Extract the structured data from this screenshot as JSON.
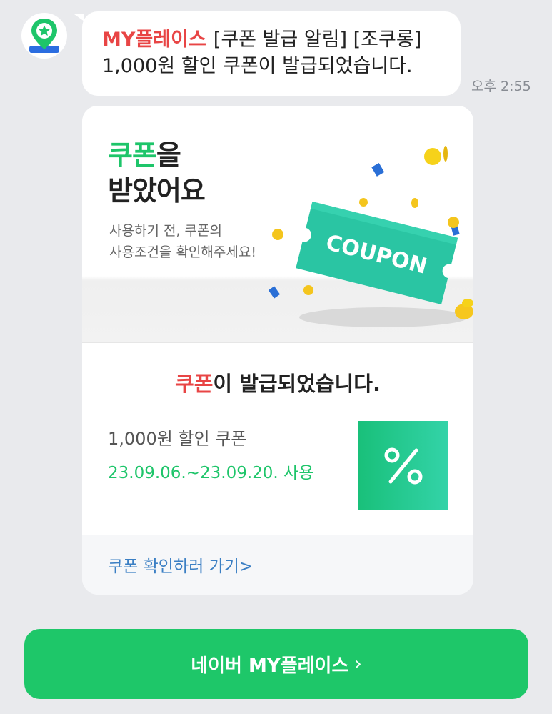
{
  "message": {
    "brand": "MY플레이스",
    "subject": "[쿠폰 발급 알림] [조쿠롱]",
    "body": "1,000원 할인 쿠폰이 발급되었습니다.",
    "timestamp": "오후 2:55"
  },
  "card": {
    "banner": {
      "title_highlight": "쿠폰",
      "title_rest_line1": "을",
      "title_line2": "받았어요",
      "subtitle_line1": "사용하기 전, 쿠폰의",
      "subtitle_line2": "사용조건을 확인해주세요!",
      "coupon_ticket_text": "COUPON"
    },
    "issued": {
      "highlight": "쿠폰",
      "rest": "이 발급되었습니다."
    },
    "coupon": {
      "name": "1,000원 할인 쿠폰",
      "period": "23.09.06.~23.09.20. 사용"
    },
    "link_label": "쿠폰 확인하러 가기>"
  },
  "cta": {
    "label": "네이버 MY플레이스",
    "chevron": "›"
  },
  "colors": {
    "brand_red": "#e84545",
    "green": "#1ec56a",
    "link_blue": "#3b7fc4",
    "cta_green": "#1ec769"
  },
  "icons": {
    "avatar": "map-pin-star-icon",
    "percent": "percent-icon"
  }
}
